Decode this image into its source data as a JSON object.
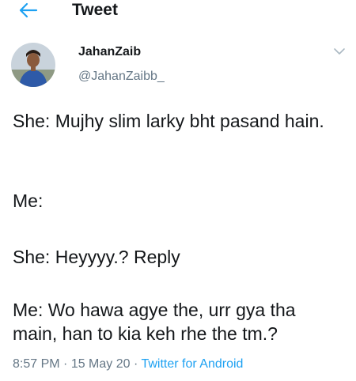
{
  "header": {
    "title": "Tweet",
    "back_icon": "arrow-left-icon",
    "accent_color": "#1da1f2"
  },
  "author": {
    "display_name": "JahanZaib",
    "handle": "@JahanZaibb_",
    "avatar_icon": "profile-photo",
    "menu_icon": "chevron-down-icon"
  },
  "tweet": {
    "paragraphs": [
      "She: Mujhy slim larky bht pasand hain.",
      "Me:",
      "She: Heyyyy.? Reply",
      "Me: Wo hawa agye the, urr gya tha main, han to kia keh rhe the tm.?"
    ]
  },
  "meta": {
    "time": "8:57 PM",
    "separator1": " · ",
    "date": "15 May 20",
    "separator2": " · ",
    "source": "Twitter for Android",
    "source_color": "#1da1f2"
  }
}
